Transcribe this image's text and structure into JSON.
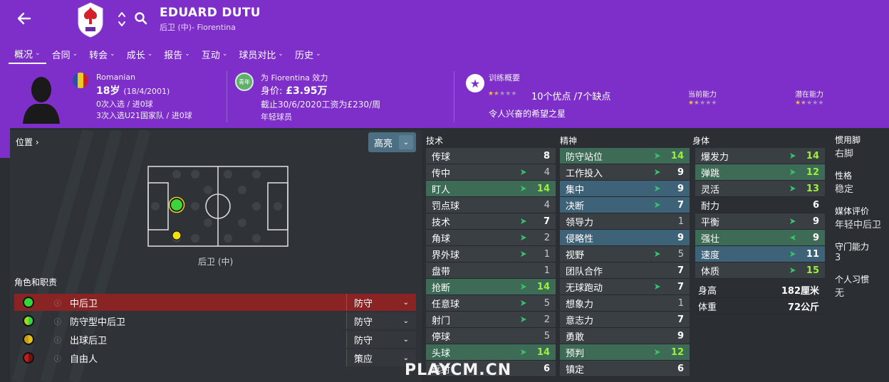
{
  "header": {
    "name": "EDUARD DUTU",
    "subtitle": "后卫 (中)- Fiorentina",
    "back_icon": "back-arrow-icon",
    "badge_icon": "fiorentina-badge-icon"
  },
  "nav": {
    "tabs": [
      {
        "label": "概况"
      },
      {
        "label": "合同"
      },
      {
        "label": "转会"
      },
      {
        "label": "成长"
      },
      {
        "label": "报告"
      },
      {
        "label": "互动"
      },
      {
        "label": "球员对比"
      },
      {
        "label": "历史"
      }
    ]
  },
  "profile": {
    "nationality": "Romanian",
    "age": "18岁",
    "dob": "(18/4/2001)",
    "caps": "0次入选 / 进0球",
    "u21_caps": "3次入选U21国家队 / 进0球",
    "club_line": "为 Fiorentina 效力",
    "youth_badge": "青年",
    "value_label": "身价:",
    "value": "£3.95万",
    "contract": "截止30/6/2020工资为£230/周",
    "squad_status": "年轻球员",
    "training_title": "训练概要",
    "training_summary": "10个优点 /7个缺点",
    "training_desc": "令人兴奋的希望之星",
    "current_ability_label": "当前能力",
    "potential_ability_label": "潜在能力",
    "training_stars": 1.5,
    "current_ability_stars": 1.5,
    "potential_ability_stars": 1.5,
    "flag_colors": [
      "#2b4fa8",
      "#f0c91e",
      "#c8202b"
    ]
  },
  "position_panel": {
    "title": "位置",
    "highlight": "高亮",
    "position_name": "后卫 (中)",
    "roles_title": "角色和职责",
    "roles": [
      {
        "name": "中后卫",
        "duty": "防守",
        "color": "#34d63a",
        "selected": true
      },
      {
        "name": "防守型中后卫",
        "duty": "防守",
        "color": "#a2d620",
        "selected": false
      },
      {
        "name": "出球后卫",
        "duty": "防守",
        "color": "#c89b1c",
        "selected": false
      },
      {
        "name": "自由人",
        "duty": "策应",
        "color": "#c41a1a",
        "selected": false
      }
    ]
  },
  "attributes": {
    "technical_title": "技术",
    "mental_title": "精神",
    "physical_title": "身体",
    "technical": [
      {
        "name": "传球",
        "value": "8",
        "arrow": "",
        "style": ""
      },
      {
        "name": "传中",
        "value": "4",
        "arrow": "up",
        "style": "dim"
      },
      {
        "name": "盯人",
        "value": "14",
        "arrow": "up",
        "style": "hl"
      },
      {
        "name": "罚点球",
        "value": "4",
        "arrow": "",
        "style": "dim"
      },
      {
        "name": "技术",
        "value": "7",
        "arrow": "up",
        "style": ""
      },
      {
        "name": "角球",
        "value": "2",
        "arrow": "up",
        "style": "dim"
      },
      {
        "name": "界外球",
        "value": "1",
        "arrow": "up",
        "style": "dim"
      },
      {
        "name": "盘带",
        "value": "1",
        "arrow": "",
        "style": "dim"
      },
      {
        "name": "抢断",
        "value": "14",
        "arrow": "up",
        "style": "hl"
      },
      {
        "name": "任意球",
        "value": "5",
        "arrow": "up",
        "style": "dim"
      },
      {
        "name": "射门",
        "value": "2",
        "arrow": "up",
        "style": "dim"
      },
      {
        "name": "停球",
        "value": "5",
        "arrow": "",
        "style": "dim"
      },
      {
        "name": "头球",
        "value": "14",
        "arrow": "up",
        "style": "hl"
      },
      {
        "name": "远射",
        "value": "6",
        "arrow": "",
        "style": ""
      }
    ],
    "mental": [
      {
        "name": "防守站位",
        "value": "14",
        "arrow": "up",
        "style": "hl"
      },
      {
        "name": "工作投入",
        "value": "9",
        "arrow": "up",
        "style": ""
      },
      {
        "name": "集中",
        "value": "9",
        "arrow": "up",
        "style": "hlb"
      },
      {
        "name": "决断",
        "value": "7",
        "arrow": "up",
        "style": "hlb"
      },
      {
        "name": "领导力",
        "value": "1",
        "arrow": "",
        "style": "dim"
      },
      {
        "name": "侵略性",
        "value": "9",
        "arrow": "",
        "style": "hlb"
      },
      {
        "name": "视野",
        "value": "5",
        "arrow": "up",
        "style": "dim"
      },
      {
        "name": "团队合作",
        "value": "7",
        "arrow": "",
        "style": ""
      },
      {
        "name": "无球跑动",
        "value": "7",
        "arrow": "up",
        "style": ""
      },
      {
        "name": "想象力",
        "value": "1",
        "arrow": "",
        "style": "dim"
      },
      {
        "name": "意志力",
        "value": "7",
        "arrow": "",
        "style": ""
      },
      {
        "name": "勇敢",
        "value": "9",
        "arrow": "",
        "style": ""
      },
      {
        "name": "预判",
        "value": "12",
        "arrow": "up",
        "style": "hl"
      },
      {
        "name": "镇定",
        "value": "6",
        "arrow": "",
        "style": ""
      }
    ],
    "physical": [
      {
        "name": "爆发力",
        "value": "14",
        "arrow": "up",
        "style": ""
      },
      {
        "name": "弹跳",
        "value": "12",
        "arrow": "up",
        "style": "hl"
      },
      {
        "name": "灵活",
        "value": "13",
        "arrow": "up",
        "style": ""
      },
      {
        "name": "耐力",
        "value": "6",
        "arrow": "",
        "style": "plainrow"
      },
      {
        "name": "平衡",
        "value": "9",
        "arrow": "up",
        "style": ""
      },
      {
        "name": "强壮",
        "value": "9",
        "arrow": "left",
        "style": "hl"
      },
      {
        "name": "速度",
        "value": "11",
        "arrow": "up",
        "style": "hlb"
      },
      {
        "name": "体质",
        "value": "15",
        "arrow": "up",
        "style": ""
      }
    ],
    "height_label": "身高",
    "height_value": "182厘米",
    "weight_label": "体重",
    "weight_value": "72公斤"
  },
  "side_info": {
    "foot_label": "惯用脚",
    "foot_value": "右脚",
    "personality_label": "性格",
    "personality_value": "稳定",
    "media_label": "媒体评价",
    "media_value": "年轻中后卫",
    "gk_label": "守门能力",
    "gk_value": "3",
    "habits_label": "个人习惯",
    "habits_value": "无"
  },
  "watermark": "PLAYCM.CN"
}
